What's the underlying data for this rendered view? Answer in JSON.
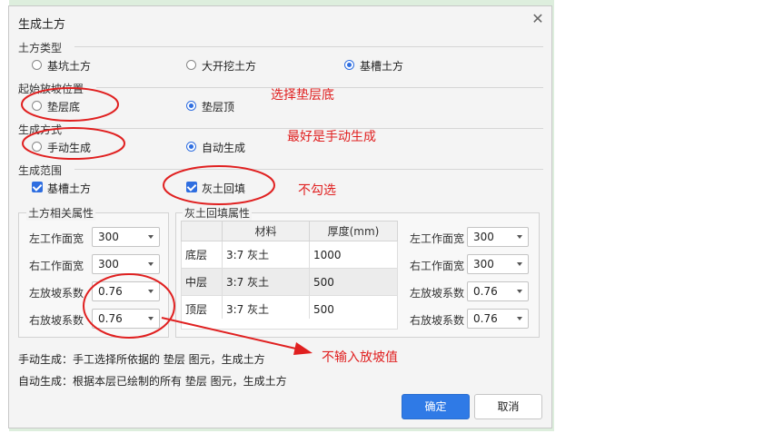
{
  "dialog": {
    "title": "生成土方",
    "close_icon": "close-icon"
  },
  "earthwork_type": {
    "label": "土方类型",
    "options": [
      {
        "label": "基坑土方",
        "selected": false
      },
      {
        "label": "大开挖土方",
        "selected": false
      },
      {
        "label": "基槽土方",
        "selected": true
      }
    ]
  },
  "slope_start": {
    "label": "起始放坡位置",
    "options": [
      {
        "label": "垫层底",
        "selected": false
      },
      {
        "label": "垫层顶",
        "selected": true
      }
    ]
  },
  "generate_mode": {
    "label": "生成方式",
    "options": [
      {
        "label": "手动生成",
        "selected": false
      },
      {
        "label": "自动生成",
        "selected": true
      }
    ]
  },
  "scope": {
    "label": "生成范围",
    "options": [
      {
        "label": "基槽土方",
        "checked": true
      },
      {
        "label": "灰土回填",
        "checked": true
      }
    ]
  },
  "earthwork_props": {
    "title": "土方相关属性",
    "fields": [
      {
        "label": "左工作面宽",
        "value": "300"
      },
      {
        "label": "右工作面宽",
        "value": "300"
      },
      {
        "label": "左放坡系数",
        "value": "0.76"
      },
      {
        "label": "右放坡系数",
        "value": "0.76"
      }
    ]
  },
  "backfill_props": {
    "title": "灰土回填属性",
    "columns": [
      "",
      "材料",
      "厚度(mm)"
    ],
    "rows": [
      {
        "name": "底层",
        "material": "3:7 灰土",
        "thickness": "1000"
      },
      {
        "name": "中层",
        "material": "3:7 灰土",
        "thickness": "500"
      },
      {
        "name": "顶层",
        "material": "3:7 灰土",
        "thickness": "500"
      }
    ],
    "fields": [
      {
        "label": "左工作面宽",
        "value": "300"
      },
      {
        "label": "右工作面宽",
        "value": "300"
      },
      {
        "label": "左放坡系数",
        "value": "0.76"
      },
      {
        "label": "右放坡系数",
        "value": "0.76"
      }
    ]
  },
  "hints": {
    "manual": "手动生成：手工选择所依据的 垫层 图元，生成土方",
    "auto": "自动生成：根据本层已绘制的所有 垫层 图元，生成土方"
  },
  "buttons": {
    "ok": "确定",
    "cancel": "取消"
  },
  "annotations": {
    "color": "#e02020",
    "note1": "选择垫层底",
    "note2": "最好是手动生成",
    "note3": "不勾选",
    "note4": "不输入放坡值"
  },
  "colors": {
    "accent": "#2f7ae6",
    "annotation": "#e02020"
  }
}
